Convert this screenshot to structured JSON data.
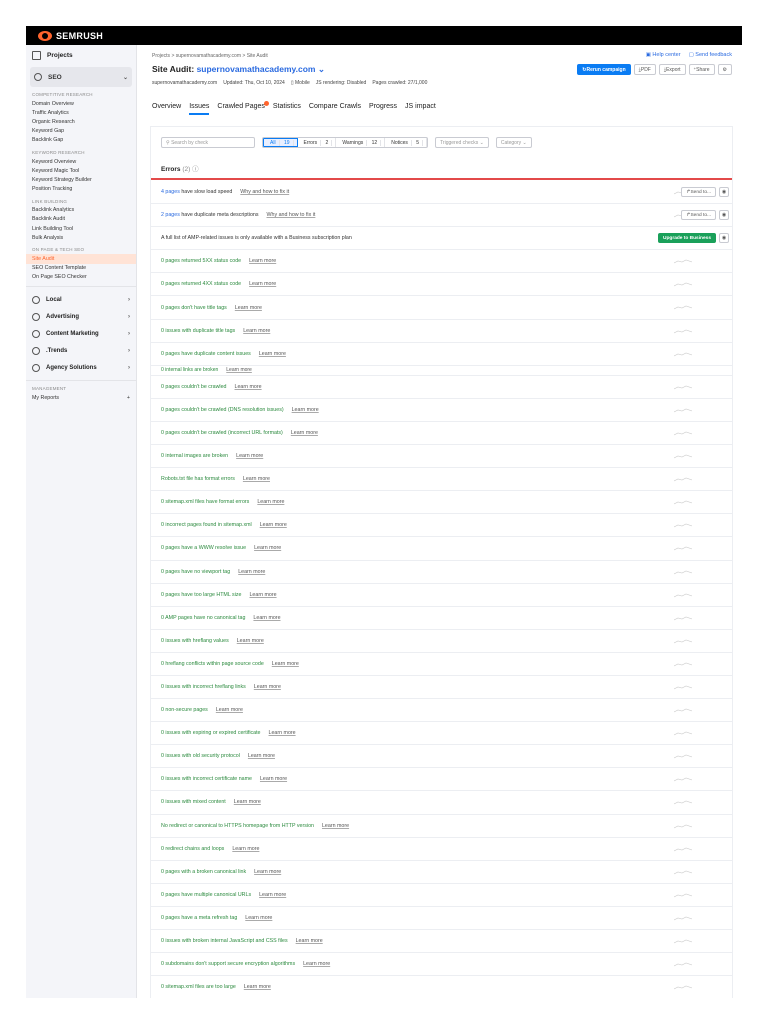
{
  "brand": "SEMRUSH",
  "colors": {
    "accent": "#ff642d",
    "primary": "#0a7cf3",
    "error": "#e34a4a",
    "upgrade": "#1aa05a",
    "issue_text": "#2b8a3e"
  },
  "sidebar": {
    "projects": "Projects",
    "seo": "SEO",
    "sections": [
      {
        "title": "COMPETITIVE RESEARCH",
        "items": [
          "Domain Overview",
          "Traffic Analytics",
          "Organic Research",
          "Keyword Gap",
          "Backlink Gap"
        ]
      },
      {
        "title": "KEYWORD RESEARCH",
        "items": [
          "Keyword Overview",
          "Keyword Magic Tool",
          "Keyword Strategy Builder",
          "Position Tracking"
        ]
      },
      {
        "title": "LINK BUILDING",
        "items": [
          "Backlink Analytics",
          "Backlink Audit",
          "Link Building Tool",
          "Bulk Analysis"
        ]
      },
      {
        "title": "ON PAGE & TECH SEO",
        "items": [
          "Site Audit",
          "SEO Content Template",
          "On Page SEO Checker"
        ]
      }
    ],
    "active_item": "Site Audit",
    "categories": [
      "Local",
      "Advertising",
      "Content Marketing",
      ".Trends",
      "Agency Solutions"
    ],
    "management_title": "MANAGEMENT",
    "my_reports": "My Reports"
  },
  "header": {
    "breadcrumb": [
      "Projects",
      "supernovamathacademy.com",
      "Site Audit"
    ],
    "help_center": "Help center",
    "send_feedback": "Send feedback",
    "title_prefix": "Site Audit:",
    "domain": "supernovamathacademy.com",
    "meta": {
      "domain": "supernovamathacademy.com",
      "updated": "Updated: Thu, Oct 10, 2024",
      "device": "Mobile",
      "js_rendering": "JS rendering: Disabled",
      "pages_crawled": "Pages crawled: 27/1,000"
    },
    "rerun": "Rerun campaign",
    "pdf": "PDF",
    "export": "Export",
    "share": "Share"
  },
  "tabs": [
    "Overview",
    "Issues",
    "Crawled Pages",
    "Statistics",
    "Compare Crawls",
    "Progress",
    "JS impact"
  ],
  "active_tab": "Issues",
  "filters": {
    "search_placeholder": "Search by check",
    "all_label": "All",
    "all_count": "19",
    "errors_label": "Errors",
    "errors_count": "2",
    "warnings_label": "Warnings",
    "warnings_count": "12",
    "notices_label": "Notices",
    "notices_count": "5",
    "triggered": "Triggered checks",
    "category": "Category"
  },
  "errors_heading": "Errors",
  "errors_count": "(2)",
  "issues": [
    {
      "count": "4 pages",
      "text": "have slow load speed",
      "link": "Why and how to fix it",
      "send": "Send to...",
      "active": true
    },
    {
      "count": "2 pages",
      "text": "have duplicate meta descriptions",
      "link": "Why and how to fix it",
      "send": "Send to...",
      "active": true
    },
    {
      "count": "",
      "text": "A full list of AMP-related issues is only available with a Business subscription plan",
      "upgrade": "Upgrade to Business",
      "amp": true
    },
    {
      "text": "0 pages returned 5XX status code",
      "link": "Learn more"
    },
    {
      "text": "0 pages returned 4XX status code",
      "link": "Learn more"
    },
    {
      "text": "0 pages don't have title tags",
      "link": "Learn more"
    },
    {
      "text": "0 issues with duplicate title tags",
      "link": "Learn more"
    },
    {
      "text": "0 pages have duplicate content issues",
      "link": "Learn more"
    },
    {
      "text": "0 internal links are broken",
      "link": "Learn more",
      "partial": true
    },
    {
      "text": "0 pages couldn't be crawled",
      "link": "Learn more"
    },
    {
      "text": "0 pages couldn't be crawled (DNS resolution issues)",
      "link": "Learn more"
    },
    {
      "text": "0 pages couldn't be crawled (incorrect URL formats)",
      "link": "Learn more"
    },
    {
      "text": "0 internal images are broken",
      "link": "Learn more"
    },
    {
      "text": "Robots.txt file has format errors",
      "link": "Learn more"
    },
    {
      "text": "0 sitemap.xml files have format errors",
      "link": "Learn more"
    },
    {
      "text": "0 incorrect pages found in sitemap.xml",
      "link": "Learn more"
    },
    {
      "text": "0 pages have a WWW resolve issue",
      "link": "Learn more"
    },
    {
      "text": "0 pages have no viewport tag",
      "link": "Learn more"
    },
    {
      "text": "0 pages have too large HTML size",
      "link": "Learn more"
    },
    {
      "text": "0 AMP pages have no canonical tag",
      "link": "Learn more"
    },
    {
      "text": "0 issues with hreflang values",
      "link": "Learn more"
    },
    {
      "text": "0 hreflang conflicts within page source code",
      "link": "Learn more"
    },
    {
      "text": "0 issues with incorrect hreflang links",
      "link": "Learn more"
    },
    {
      "text": "0 non-secure pages",
      "link": "Learn more"
    },
    {
      "text": "0 issues with expiring or expired certificate",
      "link": "Learn more"
    },
    {
      "text": "0 issues with old security protocol",
      "link": "Learn more"
    },
    {
      "text": "0 issues with incorrect certificate name",
      "link": "Learn more"
    },
    {
      "text": "0 issues with mixed content",
      "link": "Learn more"
    },
    {
      "text": "No redirect or canonical to HTTPS homepage from HTTP version",
      "link": "Learn more"
    },
    {
      "text": "0 redirect chains and loops",
      "link": "Learn more"
    },
    {
      "text": "0 pages with a broken canonical link",
      "link": "Learn more"
    },
    {
      "text": "0 pages have multiple canonical URLs",
      "link": "Learn more"
    },
    {
      "text": "0 pages have a meta refresh tag",
      "link": "Learn more"
    },
    {
      "text": "0 issues with broken internal JavaScript and CSS files",
      "link": "Learn more"
    },
    {
      "text": "0 subdomains don't support secure encryption algorithms",
      "link": "Learn more"
    },
    {
      "text": "0 sitemap.xml files are too large",
      "link": "Learn more"
    }
  ]
}
